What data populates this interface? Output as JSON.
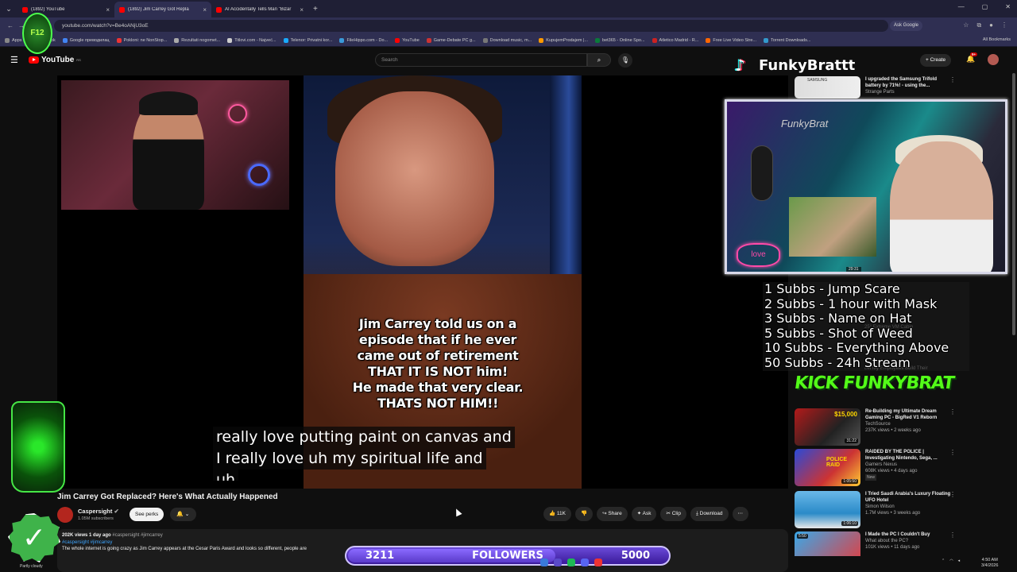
{
  "browser": {
    "tabs": [
      {
        "title": "(1892) YouTube"
      },
      {
        "title": "(1892) Jim Carrey Got Repla"
      },
      {
        "title": "AI Accidentally Tells Man \"Bizar"
      }
    ],
    "url": "youtube.com/watch?v=Be4oANjU3oE",
    "ask_google": "Ask Google",
    "bookmarks": [
      "Apps",
      "Facebook",
      "Google преводилац",
      "Pokloni: ne NonStop...",
      "Rezultati nogomet...",
      "Titlovi.com - Najveć...",
      "Telenor: Privatni kor...",
      "FileHippo.com - Do...",
      "YouTube",
      "Game-Debate PC g...",
      "Download music, m...",
      "KupujemProdajem |...",
      "bet365 - Online Spo...",
      "Atletico Madrid - R...",
      "Free Live Video Stre...",
      "Torrent Downloads..."
    ],
    "all_bookmarks": "All Bookmarks"
  },
  "youtube": {
    "logo": "YouTube",
    "country": "RS",
    "search_placeholder": "Search",
    "create_label": "Create",
    "notif_count": "9+"
  },
  "video": {
    "overlay_lines": [
      "Jim Carrey told us on a",
      "episode that if he ever",
      "came out of retirement",
      "THAT IT IS NOT him!",
      "He made that very clear.",
      "THATS NOT HIM!!"
    ],
    "caption_lines": [
      "really love putting paint on canvas and",
      "I really love uh my spiritual life and",
      "uh"
    ],
    "title": "Jim Carrey Got Replaced? Here's What Actually Happened",
    "channel": "Caspersight",
    "subscribers": "1.05M subscribers",
    "see_perks": "See perks",
    "likes": "11K",
    "share": "Share",
    "ask": "Ask",
    "clip": "Clip",
    "download": "Download",
    "views": "202K views",
    "age": "1 day ago",
    "tags_inline": "#caspersight #jimcarrey",
    "tags_line": "#caspersight #jimcarrey",
    "description": "The whole internet is going crazy as Jim Carrey appears at the Cesar Paris Award and looks so different, people are"
  },
  "stream": {
    "channel_logo_text": "F12",
    "tiktok_name": "FunkyBrattt",
    "cam_logo": "FunkyBrat",
    "cam_time": "29:31",
    "neon_sign": "love",
    "subs_lines": [
      "1 Subbs - Jump Scare",
      "2 Subbs - 1 hour with Mask",
      "3 Subbs - Name on Hat",
      "5 Subbs - Shot of Weed",
      "10 Subbs - Everything Above",
      "50 Subbs - 24h Stream"
    ],
    "kick_label": "KICK FUNKYBRAT",
    "followers_current": "3211",
    "followers_label": "FOLLOWERS",
    "followers_goal": "5000",
    "followers_progress": 0.642,
    "weather": "Partly cloudy",
    "clock_time": "4:50 AM",
    "clock_date": "3/4/2026"
  },
  "sidebar": {
    "top_item": {
      "title": "I upgraded the Samsung Trifold battery by 71%! - using the...",
      "channel": "Strange Parts",
      "thumb_label": "SAMSUNG"
    },
    "faint_items": [
      "...1% Wild Rich",
      "25° Extreme VM Cabin",
      "Let My Employees Build Their"
    ],
    "items": [
      {
        "title": "Re-Building my Ultimate Dream Gaming PC - BigRed V1 Reborn",
        "channel": "TechSource",
        "meta": "237K views • 2 weeks ago",
        "duration": "31:22",
        "thumb_label": "$15,000"
      },
      {
        "title": "RAIDED BY THE POLICE | Investigating Nintendo, Sega, ...",
        "channel": "Gamers Nexus",
        "meta": "608K views • 4 days ago",
        "badge": "New",
        "duration": "1:05:50",
        "thumb_label": "POLICE RAID"
      },
      {
        "title": "I Tried Saudi Arabia's Luxury Floating UFO Hotel",
        "channel": "Simon Wilson",
        "meta": "1.7M views • 3 weeks ago",
        "duration": "1:06:10"
      },
      {
        "title": "I Made the PC I Couldn't Buy",
        "channel": "What about the PC?",
        "meta": "101K views • 11 days ago",
        "duration": "5:50"
      }
    ]
  },
  "colors": {
    "accent": "#ff0000",
    "kick": "#53fc18",
    "followers_bar": "#6a4ad8"
  }
}
